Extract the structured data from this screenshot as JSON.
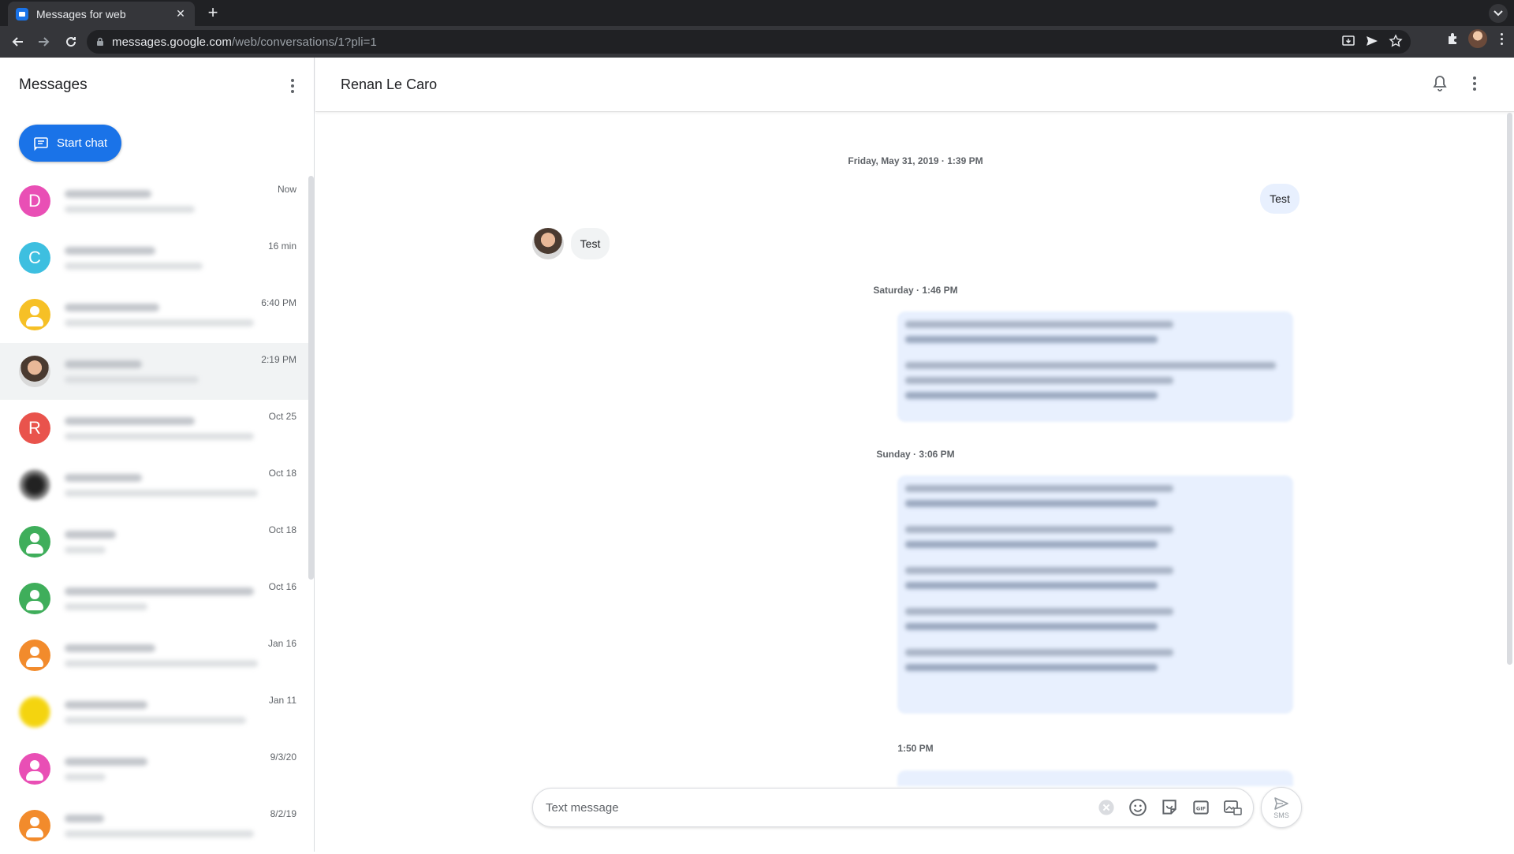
{
  "browser": {
    "tab_title": "Messages for web",
    "url_host": "messages.google.com",
    "url_path": "/web/conversations/1?pli=1"
  },
  "sidebar": {
    "title": "Messages",
    "start_chat_label": "Start chat",
    "conversations": [
      {
        "avatar_type": "letter",
        "letter": "D",
        "color": "#e94fb5",
        "time": "Now"
      },
      {
        "avatar_type": "letter",
        "letter": "C",
        "color": "#3dbfe0",
        "time": "16 min"
      },
      {
        "avatar_type": "person",
        "color": "#f6c026",
        "time": "6:40 PM"
      },
      {
        "avatar_type": "photo",
        "time": "2:19 PM",
        "selected": true
      },
      {
        "avatar_type": "letter",
        "letter": "R",
        "color": "#e9534c",
        "time": "Oct 25"
      },
      {
        "avatar_type": "blurred",
        "time": "Oct 18"
      },
      {
        "avatar_type": "person",
        "color": "#3fae5b",
        "time": "Oct 18"
      },
      {
        "avatar_type": "person",
        "color": "#3fae5b",
        "time": "Oct 16"
      },
      {
        "avatar_type": "person",
        "color": "#f28b2c",
        "time": "Jan 16"
      },
      {
        "avatar_type": "blurred-yellow",
        "time": "Jan 11"
      },
      {
        "avatar_type": "person",
        "color": "#e94fb5",
        "time": "9/3/20"
      },
      {
        "avatar_type": "person",
        "color": "#f28b2c",
        "time": "8/2/19"
      }
    ]
  },
  "conversation": {
    "contact_name": "Renan Le Caro",
    "stamps": {
      "first": "Friday, May 31, 2019 · 1:39 PM",
      "second": "Saturday · 1:46 PM",
      "third": "Sunday · 3:06 PM",
      "fourth": "1:50 PM"
    },
    "messages": {
      "outgoing_test": "Test",
      "incoming_test": "Test"
    },
    "composer": {
      "placeholder": "Text message",
      "send_label": "SMS"
    }
  },
  "colors": {
    "accent": "#1a73e8",
    "outgoing_bubble": "#e8f0fe",
    "incoming_bubble": "#f1f3f4"
  }
}
